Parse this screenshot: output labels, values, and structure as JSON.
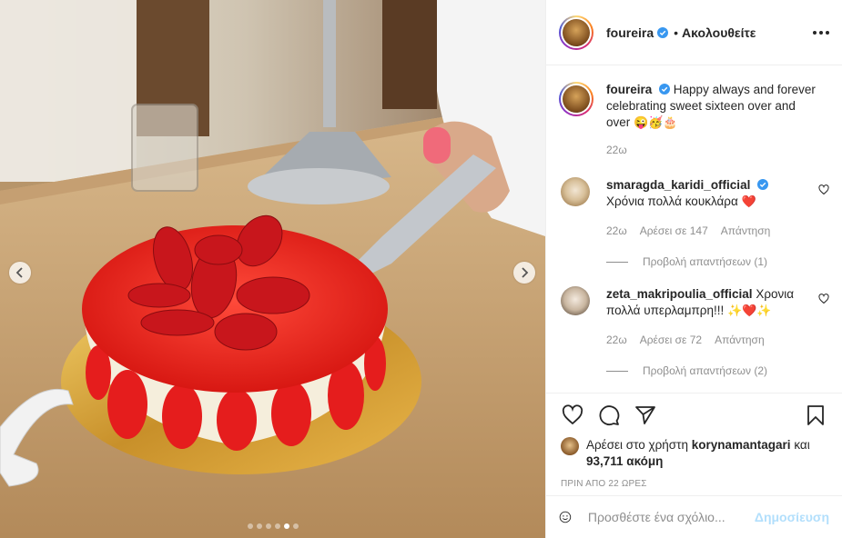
{
  "colors": {
    "accent": "#0095f6",
    "post_disabled": "#b2dffc",
    "muted": "#8e8e8e",
    "text": "#262626",
    "heart_red": "#ed4956"
  },
  "header": {
    "username": "foureira",
    "verified": true,
    "separator": "•",
    "follow_status": "Ακολουθείτε",
    "more_icon": "more-horizontal-icon"
  },
  "caption": {
    "username": "foureira",
    "text": "Happy always and forever celebrating sweet sixteen over and over",
    "emojis": "😜🥳🎂",
    "time": "22ω"
  },
  "comments": [
    {
      "username": "smaragda_karidi_official",
      "verified": true,
      "text": "Χρόνια πολλά κουκλάρα",
      "emojis": "❤️",
      "time": "22ω",
      "likes": "Αρέσει σε 147",
      "reply": "Απάντηση",
      "view_replies": "Προβολή απαντήσεων (1)"
    },
    {
      "username": "zeta_makripoulia_official",
      "verified": false,
      "text": "Χρονια πολλά υπερλαμπρη!!!",
      "emojis": "✨❤️✨",
      "time": "22ω",
      "likes": "Αρέσει σε 72",
      "reply": "Απάντηση",
      "view_replies": "Προβολή απαντήσεων (2)"
    }
  ],
  "actions": {
    "like_icon": "heart-icon",
    "comment_icon": "comment-icon",
    "share_icon": "share-icon",
    "save_icon": "bookmark-icon"
  },
  "likes": {
    "prefix": "Αρέσει στο χρήστη",
    "user": "korynamantagari",
    "middle": "και",
    "others": "93,711 ακόμη"
  },
  "timeago": "ΠΡΙΝ ΑΠΟ 22 ΩΡΕΣ",
  "add_comment": {
    "placeholder": "Προσθέστε ένα σχόλιο...",
    "post_label": "Δημοσίευση"
  },
  "carousel": {
    "total": 6,
    "current": 5,
    "prev_icon": "chevron-left-icon",
    "next_icon": "chevron-right-icon"
  }
}
